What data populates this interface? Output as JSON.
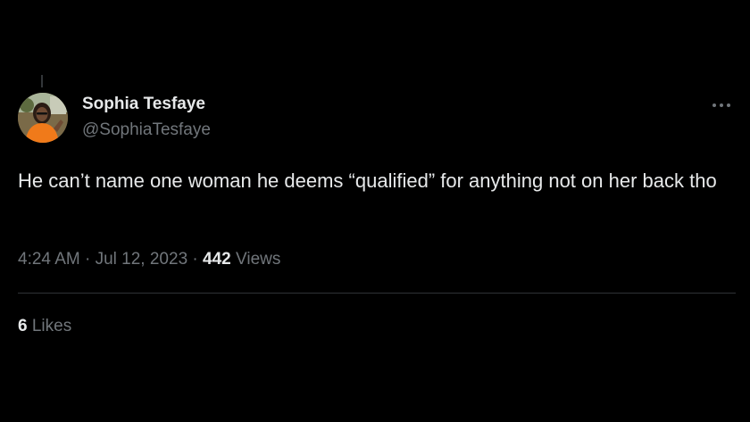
{
  "tweet": {
    "author": {
      "display_name": "Sophia Tesfaye",
      "handle": "@SophiaTesfaye",
      "avatar_icon": "profile-photo-avatar"
    },
    "text": "He can’t name one woman he deems “qualified” for anything not on her back tho",
    "time": "4:24 AM",
    "separator": "·",
    "date": "Jul 12, 2023",
    "views_count": "442",
    "views_label": "Views",
    "likes_count": "6",
    "likes_label": "Likes",
    "more_icon": "more-options-icon"
  },
  "colors": {
    "background": "#000000",
    "primary_text": "#e7e9ea",
    "secondary_text": "#71767b",
    "divider": "#2f3336",
    "avatar_shirt": "#f07a1a"
  }
}
